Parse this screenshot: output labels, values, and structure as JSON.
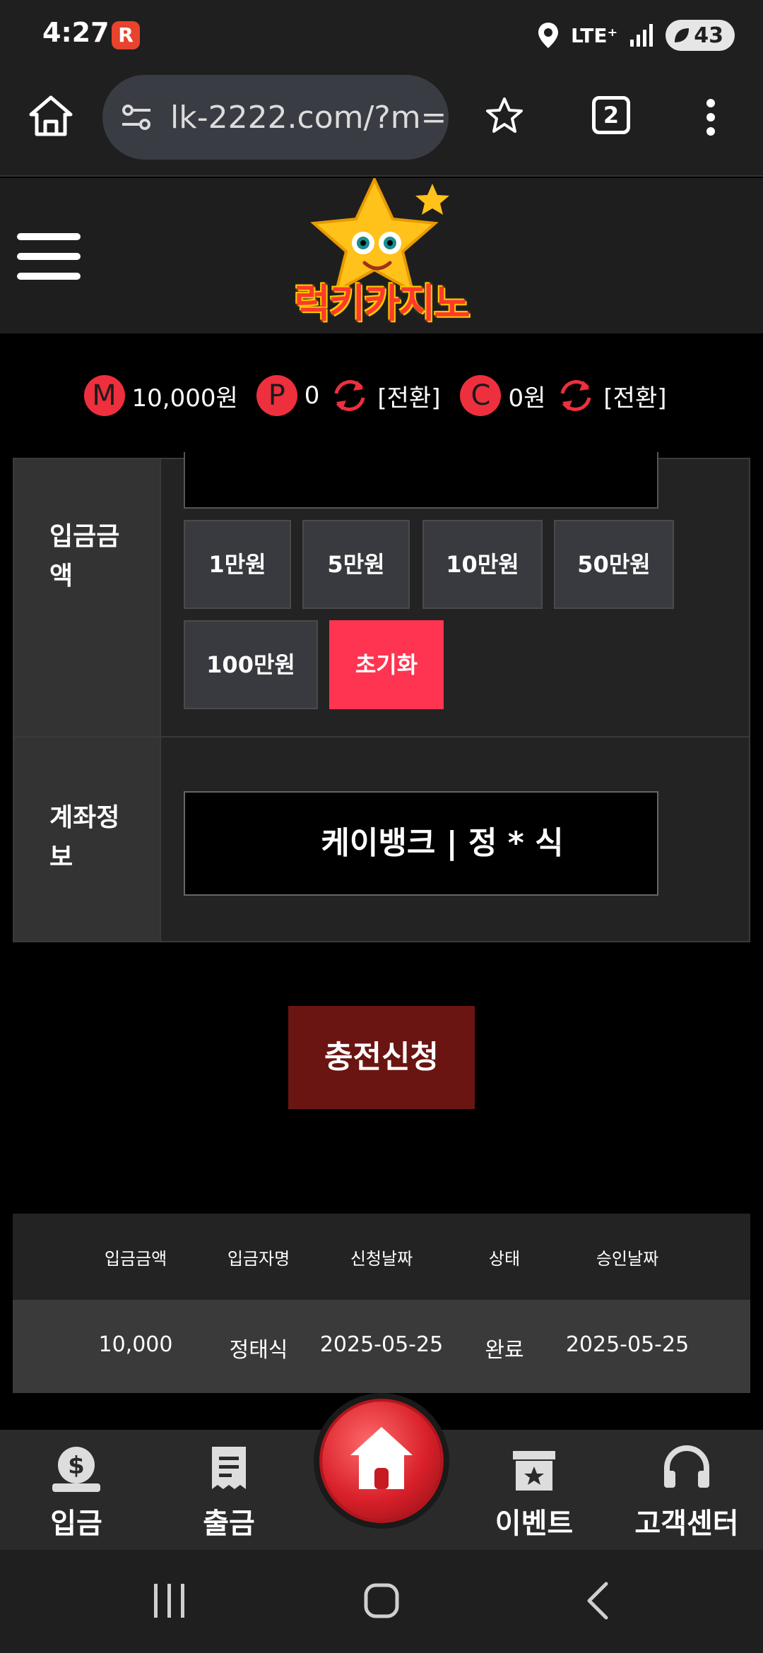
{
  "status_bar": {
    "time": "4:27",
    "app_icon_letter": "R",
    "network": "LTE⁺",
    "battery": "43"
  },
  "browser": {
    "url": "lk-2222.com/?m=",
    "tab_count": "2"
  },
  "site": {
    "logo_text": "럭키카지노"
  },
  "balance": {
    "money_badge": "M",
    "money_value": "10,000원",
    "point_badge": "P",
    "point_value": "0",
    "point_convert_label": "[전환]",
    "casino_badge": "C",
    "casino_value": "0원",
    "casino_convert_label": "[전환]"
  },
  "form": {
    "amount_label": "입금금액",
    "amount_buttons": [
      "1만원",
      "5만원",
      "10만원",
      "50만원",
      "100만원"
    ],
    "reset_label": "초기화",
    "account_label": "계좌정보",
    "account_value": "케이뱅크 | 정 * 식"
  },
  "submit": {
    "label": "충전신청"
  },
  "history": {
    "columns": [
      "입금금액",
      "입금자명",
      "신청날짜",
      "상태",
      "승인날짜"
    ],
    "rows": [
      [
        "10,000",
        "정태식",
        "2025-05-25",
        "완료",
        "2025-05-25"
      ]
    ]
  },
  "bottom_nav": {
    "items": [
      "입금",
      "출금",
      "이벤트",
      "고객센터"
    ]
  },
  "colors": {
    "accent_red": "#ff3450",
    "badge_red": "#ee2f3d",
    "submit_bg": "#6a1511"
  }
}
